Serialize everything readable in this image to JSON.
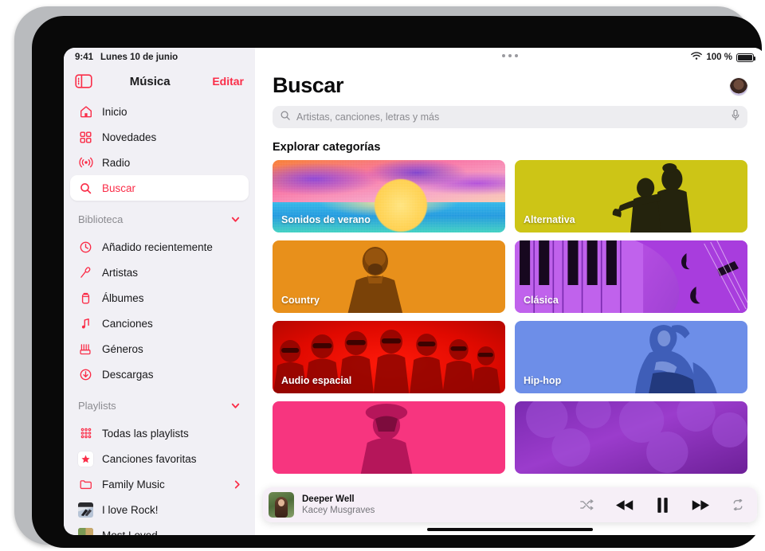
{
  "statusbar": {
    "time": "9:41",
    "date": "Lunes 10 de junio",
    "battery_percent": "100 %",
    "wifi_icon": "wifi-icon",
    "battery_icon": "battery-full-icon"
  },
  "sidebar": {
    "toggle_icon": "sidebar-toggle-icon",
    "title": "Música",
    "edit_label": "Editar",
    "nav": [
      {
        "label": "Inicio",
        "icon": "home-icon",
        "active": false
      },
      {
        "label": "Novedades",
        "icon": "grid-icon",
        "active": false
      },
      {
        "label": "Radio",
        "icon": "radio-broadcast-icon",
        "active": false
      },
      {
        "label": "Buscar",
        "icon": "search-icon",
        "active": true
      }
    ],
    "library": {
      "title": "Biblioteca",
      "chevron_icon": "chevron-down-icon",
      "items": [
        {
          "label": "Añadido recientemente",
          "icon": "clock-icon"
        },
        {
          "label": "Artistas",
          "icon": "microphone-icon"
        },
        {
          "label": "Álbumes",
          "icon": "album-icon"
        },
        {
          "label": "Canciones",
          "icon": "music-note-icon"
        },
        {
          "label": "Géneros",
          "icon": "genres-icon"
        },
        {
          "label": "Descargas",
          "icon": "download-circle-icon"
        }
      ]
    },
    "playlists": {
      "title": "Playlists",
      "chevron_icon": "chevron-down-icon",
      "items": [
        {
          "label": "Todas las playlists",
          "icon": "playlist-grid-icon"
        },
        {
          "label": "Canciones favoritas",
          "icon": "star-icon"
        },
        {
          "label": "Family Music",
          "icon": "folder-icon",
          "chevron_icon": "chevron-right-icon"
        },
        {
          "label": "I love Rock!",
          "icon": "playlist-artwork"
        },
        {
          "label": "Most Loved",
          "icon": "playlist-artwork"
        }
      ]
    }
  },
  "main": {
    "multitasking_icon": "multitasking-dots-icon",
    "page_title": "Buscar",
    "avatar_icon": "user-avatar",
    "search": {
      "placeholder": "Artistas, canciones, letras y más",
      "search_icon": "search-icon",
      "mic_icon": "microphone-icon"
    },
    "section_title": "Explorar categorías",
    "categories": [
      {
        "label": "Sonidos de verano",
        "art": "sunset",
        "color": "#f86ea0"
      },
      {
        "label": "Alternativa",
        "art": "alternative",
        "color": "#cdc516"
      },
      {
        "label": "Country",
        "art": "country",
        "color": "#e8901b"
      },
      {
        "label": "Clásica",
        "art": "classical",
        "color": "#9b3fd4"
      },
      {
        "label": "Audio espacial",
        "art": "spatial",
        "color": "#e00900"
      },
      {
        "label": "Hip-hop",
        "art": "hiphop",
        "color": "#6d8ee8"
      },
      {
        "label": "",
        "art": "pink",
        "color": "#f7357f"
      },
      {
        "label": "",
        "art": "purple",
        "color": "#7a2ab0"
      }
    ]
  },
  "now_playing": {
    "title": "Deeper Well",
    "artist": "Kacey Musgraves",
    "artwork_icon": "album-artwork",
    "controls": [
      {
        "name": "shuffle-button",
        "icon": "shuffle-icon",
        "state": "inactive"
      },
      {
        "name": "previous-button",
        "icon": "rewind-icon",
        "state": "active"
      },
      {
        "name": "pause-button",
        "icon": "pause-icon",
        "state": "active"
      },
      {
        "name": "next-button",
        "icon": "fast-forward-icon",
        "state": "active"
      },
      {
        "name": "repeat-button",
        "icon": "repeat-icon",
        "state": "inactive"
      }
    ]
  },
  "colors": {
    "accent": "#fa2d48",
    "sidebar_bg": "#f1f0f5",
    "main_bg": "#ffffff",
    "muted_text": "#8b8b90"
  }
}
